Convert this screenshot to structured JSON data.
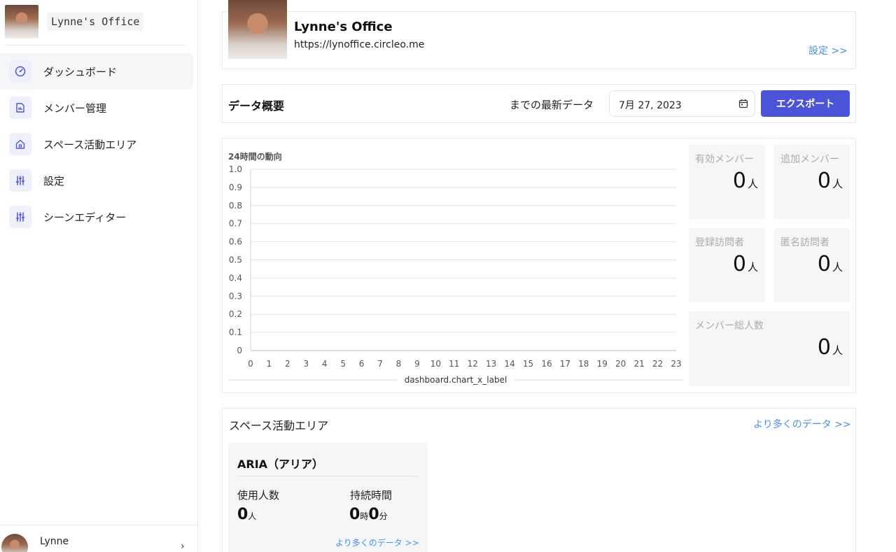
{
  "sidebar": {
    "brand_name": "Lynne's Office",
    "items": [
      {
        "label": "ダッシュボード",
        "icon": "gauge-icon"
      },
      {
        "label": "メンバー管理",
        "icon": "report-icon"
      },
      {
        "label": "スペース活動エリア",
        "icon": "home-icon"
      },
      {
        "label": "設定",
        "icon": "sliders-icon"
      },
      {
        "label": "シーンエディター",
        "icon": "sliders-icon"
      }
    ],
    "user_name": "Lynne"
  },
  "office": {
    "title": "Lynne's Office",
    "url": "https://lynoffice.circleo.me",
    "settings_link": "設定 >>"
  },
  "overview": {
    "title": "データ概要",
    "latest_label": "までの最新データ",
    "date_value": "7月 27, 2023",
    "export_label": "エクスポート"
  },
  "chart_data": {
    "type": "line",
    "title": "24時間の動向",
    "xlabel": "dashboard.chart_x_label",
    "ylabel": "",
    "x": [
      0,
      1,
      2,
      3,
      4,
      5,
      6,
      7,
      8,
      9,
      10,
      11,
      12,
      13,
      14,
      15,
      16,
      17,
      18,
      19,
      20,
      21,
      22,
      23
    ],
    "yticks": [
      "0",
      "0.1",
      "0.2",
      "0.3",
      "0.4",
      "0.5",
      "0.6",
      "0.7",
      "0.8",
      "0.9",
      "1.0"
    ],
    "ylim": [
      0,
      1
    ],
    "grid": true,
    "series": []
  },
  "stats": {
    "active_members": {
      "label": "有効メンバー",
      "value": "0",
      "unit": "人"
    },
    "added_members": {
      "label": "追加メンバー",
      "value": "0",
      "unit": "人"
    },
    "registered_visitors": {
      "label": "登録訪問者",
      "value": "0",
      "unit": "人"
    },
    "anonymous_visitors": {
      "label": "匿名訪問者",
      "value": "0",
      "unit": "人"
    },
    "total_members": {
      "label": "メンバー総人数",
      "value": "0",
      "unit": "人"
    }
  },
  "space": {
    "title": "スペース活動エリア",
    "more_link": "より多くのデータ >>",
    "area": {
      "name": "ARIA（アリア）",
      "users_label": "使用人数",
      "users_value": "0",
      "users_unit": "人",
      "duration_label": "持続時間",
      "hours_value": "0",
      "hours_unit": "時",
      "minutes_value": "0",
      "minutes_unit": "分",
      "more_link": "より多くのデータ >>"
    }
  },
  "colors": {
    "accent": "#4b53d9",
    "link": "#4a90e2",
    "panel": "#f5f6f8"
  }
}
